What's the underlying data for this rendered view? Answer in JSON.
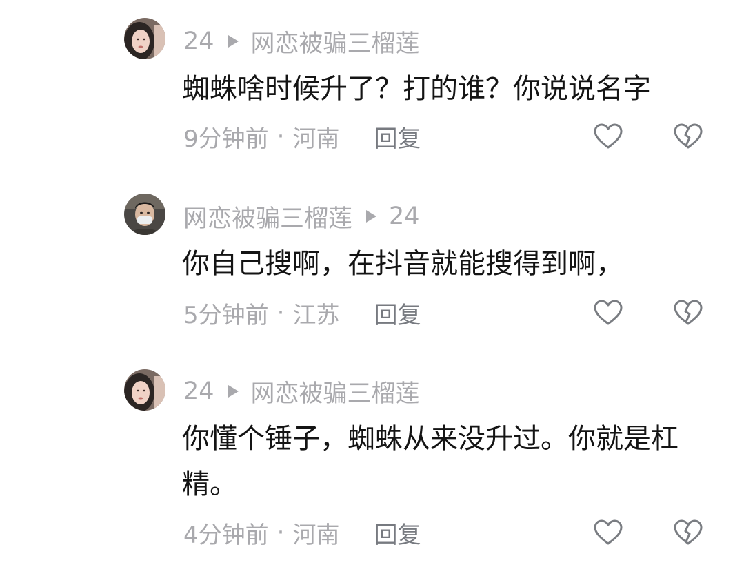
{
  "comments": [
    {
      "author": "24",
      "reply_to": "网恋被骗三榴莲",
      "text": "蜘蛛啥时候升了？打的谁？你说说名字",
      "time": "9分钟前",
      "location": "河南",
      "reply_label": "回复",
      "avatar": "avatar-woman"
    },
    {
      "author": "网恋被骗三榴莲",
      "reply_to": "24",
      "text": "你自己搜啊，在抖音就能搜得到啊，",
      "time": "5分钟前",
      "location": "江苏",
      "reply_label": "回复",
      "avatar": "avatar-man-mask"
    },
    {
      "author": "24",
      "reply_to": "网恋被骗三榴莲",
      "text": "你懂个锤子，蜘蛛从来没升过。你就是杠精。",
      "time": "4分钟前",
      "location": "河南",
      "reply_label": "回复",
      "avatar": "avatar-woman"
    }
  ],
  "separator": "·",
  "icons": {
    "like": "heart-icon",
    "dislike": "broken-heart-icon"
  },
  "colors": {
    "text": "#141414",
    "muted": "#a9a9ad",
    "reply": "#777a80",
    "background": "#ffffff"
  }
}
